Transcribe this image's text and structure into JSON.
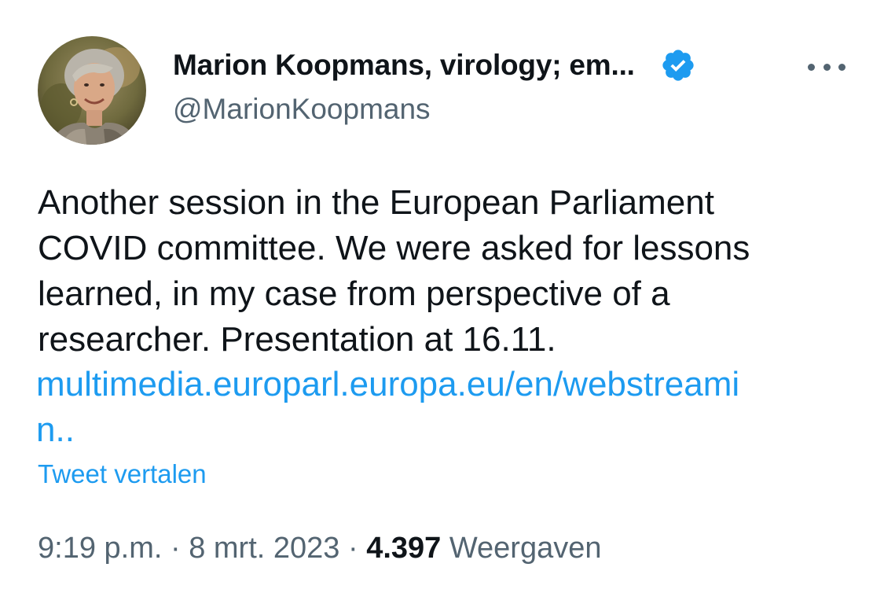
{
  "author": {
    "display_name": "Marion Koopmans, virology; em...",
    "handle": "@MarionKoopmans",
    "verified": true
  },
  "icons": {
    "avatar": "profile-photo",
    "verified": "verified-badge-icon",
    "more": "more-options-icon"
  },
  "tweet": {
    "text_lines": [
      "Another session in the European Parliament",
      "COVID committee. We were asked for lessons",
      "learned, in my case from perspective of a",
      "researcher. Presentation at 16.11."
    ],
    "link_lines": [
      "multimedia.europarl.europa.eu/en/webstreami",
      "n.."
    ],
    "translate_label": "Tweet vertalen"
  },
  "meta": {
    "time": "9:19 p.m.",
    "sep1": " · ",
    "date": "8 mrt. 2023",
    "sep2": " · ",
    "views_count": "4.397",
    "views_label": " Weergaven"
  },
  "colors": {
    "link_blue": "#1d9bf0",
    "secondary_gray": "#536471",
    "primary_text": "#0f1419"
  }
}
